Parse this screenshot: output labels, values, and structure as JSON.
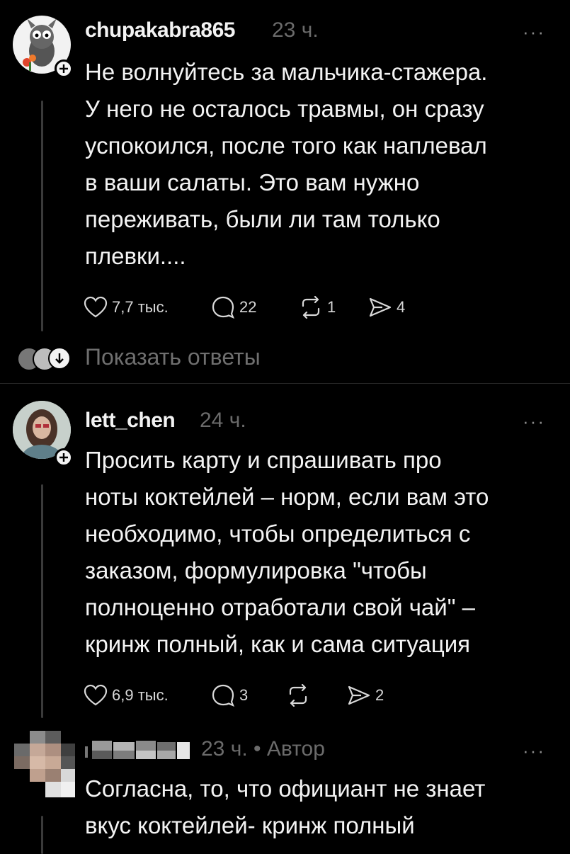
{
  "posts": [
    {
      "username": "chupakabra865",
      "time": "23 ч.",
      "text_lines": [
        "Не волнуйтесь за мальчика-стажера.",
        "У него не осталось травмы, он сразу",
        "успокоился, после того как наплевал",
        "в ваши салаты. Это вам нужно",
        "переживать, были ли там только",
        "плевки...."
      ],
      "likes": "7,7 тыс.",
      "comments": "22",
      "reposts": "1",
      "shares": "4",
      "show_replies": "Показать ответы"
    },
    {
      "username": "lett_chen",
      "time": "24 ч.",
      "text_lines": [
        "Просить карту и спрашивать про",
        "ноты коктейлей – норм, если вам это",
        "необходимо, чтобы определиться с",
        "заказом, формулировка \"чтобы",
        "полноценно отработали свой чай\" –",
        "кринж полный, как и сама ситуация"
      ],
      "likes": "6,9 тыс.",
      "comments": "3",
      "shares": "2"
    },
    {
      "meta": "23 ч. • Автор",
      "text_lines": [
        "Согласна, то, что официант не знает",
        "вкус коктейлей- кринж полный"
      ]
    }
  ],
  "more_label": "···",
  "colors": {
    "bg": "#000000",
    "text": "#f3f3f3",
    "muted": "#6b6b6b",
    "line": "#3a3a3a"
  }
}
